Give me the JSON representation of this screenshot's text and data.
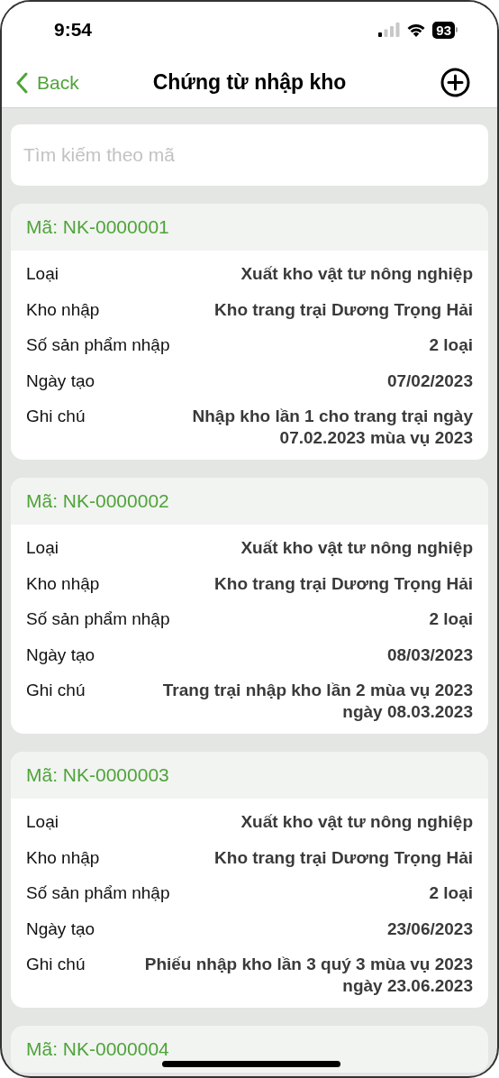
{
  "status_bar": {
    "time": "9:54",
    "battery": "93"
  },
  "nav_bar": {
    "back": "Back",
    "title": "Chứng từ nhập kho"
  },
  "search": {
    "placeholder": "Tìm kiếm theo mã"
  },
  "records": [
    {
      "code": "Mã: NK-0000001",
      "fields": [
        {
          "label": "Loại",
          "value": "Xuất kho vật tư nông nghiệp"
        },
        {
          "label": "Kho nhập",
          "value": "Kho trang trại Dương Trọng Hải"
        },
        {
          "label": "Số sản phẩm nhập",
          "value": "2 loại"
        },
        {
          "label": "Ngày tạo",
          "value": "07/02/2023"
        },
        {
          "label": "Ghi chú",
          "value": "Nhập kho lần 1 cho trang trại ngày 07.02.2023 mùa vụ 2023"
        }
      ]
    },
    {
      "code": "Mã: NK-0000002",
      "fields": [
        {
          "label": "Loại",
          "value": "Xuất kho vật tư nông nghiệp"
        },
        {
          "label": "Kho nhập",
          "value": "Kho trang trại Dương Trọng Hải"
        },
        {
          "label": "Số sản phẩm nhập",
          "value": "2 loại"
        },
        {
          "label": "Ngày tạo",
          "value": "08/03/2023"
        },
        {
          "label": "Ghi chú",
          "value": "Trang trại nhập kho lần 2 mùa vụ 2023 ngày 08.03.2023"
        }
      ]
    },
    {
      "code": "Mã: NK-0000003",
      "fields": [
        {
          "label": "Loại",
          "value": "Xuất kho vật tư nông nghiệp"
        },
        {
          "label": "Kho nhập",
          "value": "Kho trang trại Dương Trọng Hải"
        },
        {
          "label": "Số sản phẩm nhập",
          "value": "2 loại"
        },
        {
          "label": "Ngày tạo",
          "value": "23/06/2023"
        },
        {
          "label": "Ghi chú",
          "value": "Phiếu nhập kho lần 3 quý 3 mùa vụ 2023 ngày 23.06.2023"
        }
      ]
    },
    {
      "code": "Mã: NK-0000004"
    }
  ]
}
